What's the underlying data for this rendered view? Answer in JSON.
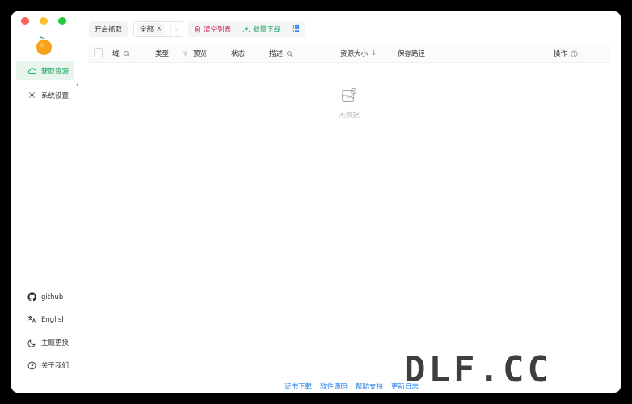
{
  "sidebar": {
    "nav": [
      {
        "label": "获取资源",
        "icon": "cloud-icon",
        "active": true
      },
      {
        "label": "系统设置",
        "icon": "gear-icon",
        "active": false
      }
    ],
    "bottom": [
      {
        "label": "github",
        "icon": "github-icon"
      },
      {
        "label": "English",
        "icon": "translate-icon"
      },
      {
        "label": "主题更换",
        "icon": "moon-icon"
      },
      {
        "label": "关于我们",
        "icon": "help-circle-icon"
      }
    ]
  },
  "toolbar": {
    "start_label": "开启抓取",
    "filter_tag": "全部",
    "clear_label": "清空列表",
    "batch_label": "批量下载"
  },
  "table": {
    "columns": [
      "域",
      "类型",
      "预览",
      "状态",
      "描述",
      "资源大小",
      "保存路径",
      "操作"
    ]
  },
  "empty_text": "无数据",
  "footer": [
    "证书下载",
    "软件源码",
    "帮助支持",
    "更新日志"
  ],
  "watermark": "DLF.CC",
  "colors": {
    "accent": "#18a058",
    "danger": "#d03050",
    "link": "#2080f0"
  }
}
